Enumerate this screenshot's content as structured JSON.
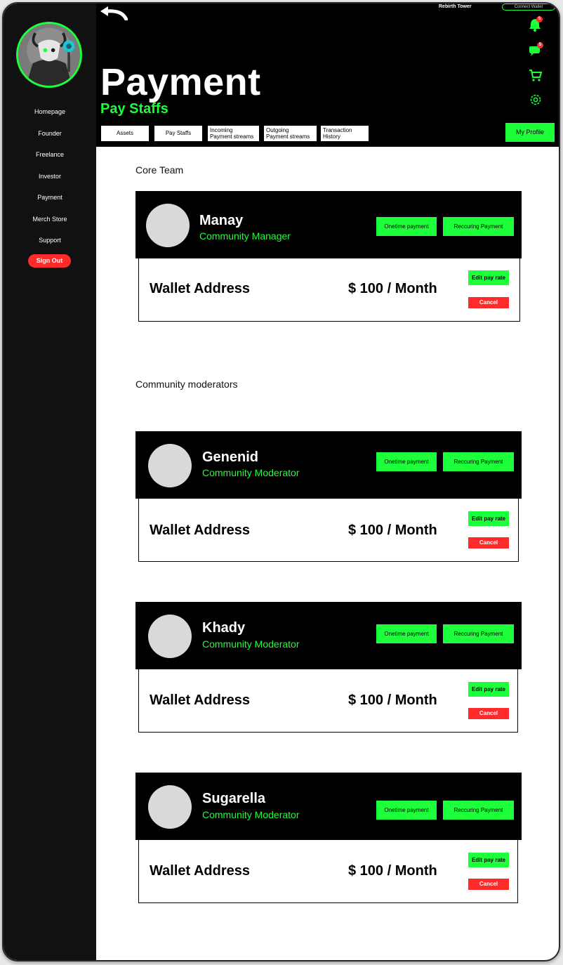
{
  "header": {
    "top_title": "Rebirth Tower",
    "connect_wallet": "Connect Wallet",
    "title": "Payment",
    "subtitle": "Pay Staffs",
    "notification_count": "5",
    "message_count": "5",
    "my_profile": "My Profile",
    "tabs": [
      {
        "line1": "Assets"
      },
      {
        "line1": "Pay Staffs"
      },
      {
        "line1": "Incoming",
        "line2": "Payment streams"
      },
      {
        "line1": "Outgoing",
        "line2": "Payment streams"
      },
      {
        "line1": "Transaction",
        "line2": "History"
      }
    ]
  },
  "sidebar": {
    "items": [
      {
        "label": "Homepage"
      },
      {
        "label": "Founder"
      },
      {
        "label": "Freelance"
      },
      {
        "label": "Investor"
      },
      {
        "label": "Payment"
      },
      {
        "label": "Merch Store"
      },
      {
        "label": "Support"
      }
    ],
    "sign_out": "Sign Out"
  },
  "sections": [
    {
      "heading": "Core Team"
    },
    {
      "heading": "Community moderators"
    }
  ],
  "staff": [
    {
      "name": "Manay",
      "role": "Community Manager",
      "onetime": "Onetime payment",
      "recurring": "Reccuring Payment",
      "wallet": "Wallet Address",
      "rate": "$ 100 / Month",
      "edit": "Edit pay rate",
      "cancel": "Cancel"
    },
    {
      "name": "Genenid",
      "role": "Community Moderator",
      "onetime": "Onetime payment",
      "recurring": "Reccuring Payment",
      "wallet": "Wallet Address",
      "rate": "$ 100 / Month",
      "edit": "Edit pay rate",
      "cancel": "Cancel"
    },
    {
      "name": "Khady",
      "role": "Community Moderator",
      "onetime": "Onetime payment",
      "recurring": "Reccuring Payment",
      "wallet": "Wallet Address",
      "rate": "$ 100 / Month",
      "edit": "Edit pay rate",
      "cancel": "Cancel"
    },
    {
      "name": "Sugarella",
      "role": "Community Moderator",
      "onetime": "Onetime payment",
      "recurring": "Reccuring Payment",
      "wallet": "Wallet Address",
      "rate": "$ 100 / Month",
      "edit": "Edit pay rate",
      "cancel": "Cancel"
    }
  ],
  "colors": {
    "accent": "#1dff3a",
    "danger": "#ff2a2a",
    "sidebar_bg": "#111111",
    "header_bg": "#000000"
  }
}
